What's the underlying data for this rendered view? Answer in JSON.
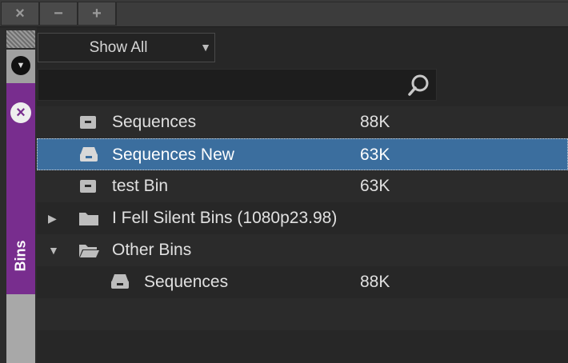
{
  "toolbar": {
    "close_label": "×",
    "minimize_label": "−",
    "add_label": "+"
  },
  "sidebar": {
    "tab_label": "Bins"
  },
  "filter": {
    "selected": "Show All",
    "arrow": "▼"
  },
  "search": {
    "value": "",
    "placeholder": ""
  },
  "bins": [
    {
      "name": "Sequences",
      "size": "88K",
      "icon": "bin-icon",
      "indent": 0,
      "selected": false
    },
    {
      "name": "Sequences New",
      "size": "63K",
      "icon": "bin-open-icon",
      "indent": 0,
      "selected": true
    },
    {
      "name": "test Bin",
      "size": "63K",
      "icon": "bin-icon",
      "indent": 0,
      "selected": false
    },
    {
      "name": "I Fell Silent Bins (1080p23.98)",
      "size": "",
      "icon": "folder-closed-icon",
      "indent": 0,
      "expander": "▶",
      "selected": false
    },
    {
      "name": "Other Bins",
      "size": "",
      "icon": "folder-open-icon",
      "indent": 0,
      "expander": "▼",
      "selected": false
    },
    {
      "name": "Sequences",
      "size": "88K",
      "icon": "bin-open-icon",
      "indent": 1,
      "selected": false
    }
  ],
  "colors": {
    "selected_row": "#3b6e9e",
    "bins_tab": "#782d8e"
  }
}
